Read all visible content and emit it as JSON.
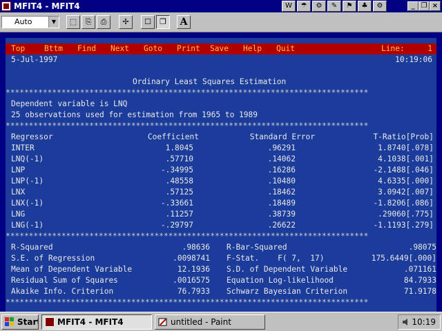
{
  "window": {
    "title": "MFIT4 - MFIT4",
    "controls": [
      "_",
      "❐",
      "×"
    ],
    "title_tools": [
      "W",
      "☂",
      "⚙",
      "✎",
      "⚑",
      "♣",
      "⚙"
    ]
  },
  "toolbar": {
    "font_size_value": "Auto",
    "dropdown_arrow": "▼",
    "buttons": [
      "⬚",
      "⎘",
      "⎙",
      "✢",
      "☐",
      "❐"
    ],
    "font_button": "A"
  },
  "menu": {
    "items": [
      "Top",
      "Bttm",
      "Find",
      "Next",
      "Goto",
      "Print",
      "Save",
      "Help",
      "Quit"
    ],
    "line_label": "Line:",
    "line_value": "1"
  },
  "header": {
    "date": "5-Jul-1997",
    "time": "10:19:06"
  },
  "report": {
    "title": "Ordinary Least Squares Estimation",
    "separator": "******************************************************************************",
    "dependent": "Dependent variable is LNQ",
    "observations": "25 observations used for estimation from 1965 to 1989",
    "columns": [
      "Regressor",
      "Coefficient",
      "Standard Error",
      "T-Ratio[Prob]"
    ],
    "rows": [
      {
        "name": "INTER",
        "coef": "1.8045",
        "se": ".96291",
        "t": "1.8740[.078]"
      },
      {
        "name": "LNQ(-1)",
        "coef": ".57710",
        "se": ".14062",
        "t": "4.1038[.001]"
      },
      {
        "name": "LNP",
        "coef": "-.34995",
        "se": ".16286",
        "t": "-2.1488[.046]"
      },
      {
        "name": "LNP(-1)",
        "coef": ".48558",
        "se": ".10480",
        "t": "4.6335[.000]"
      },
      {
        "name": "LNX",
        "coef": ".57125",
        "se": ".18462",
        "t": "3.0942[.007]"
      },
      {
        "name": "LNX(-1)",
        "coef": "-.33661",
        "se": ".18489",
        "t": "-1.8206[.086]"
      },
      {
        "name": "LNG",
        "coef": ".11257",
        "se": ".38739",
        "t": ".29060[.775]"
      },
      {
        "name": "LNG(-1)",
        "coef": "-.29797",
        "se": ".26622",
        "t": "-1.1193[.279]"
      }
    ],
    "stats": [
      {
        "l_label": "R-Squared",
        "l_val": ".98636",
        "r_label": "R-Bar-Squared",
        "r_val": ".98075"
      },
      {
        "l_label": "S.E. of Regression",
        "l_val": ".0098741",
        "r_label": "F-Stat.    F( 7,  17)",
        "r_val": "175.6449[.000]"
      },
      {
        "l_label": "Mean of Dependent Variable",
        "l_val": "12.1936",
        "r_label": "S.D. of Dependent Variable",
        "r_val": ".071161"
      },
      {
        "l_label": "Residual Sum of Squares",
        "l_val": ".0016575",
        "r_label": "Equation Log-likelihood",
        "r_val": "84.7933"
      },
      {
        "l_label": "Akaike Info. Criterion",
        "l_val": "76.7933",
        "r_label": "Schwarz Bayesian Criterion",
        "r_val": "71.9178"
      }
    ]
  },
  "taskbar": {
    "start_label": "Start",
    "tasks": [
      "MFIT4 - MFIT4",
      "untitled - Paint"
    ],
    "clock": "10:19"
  }
}
